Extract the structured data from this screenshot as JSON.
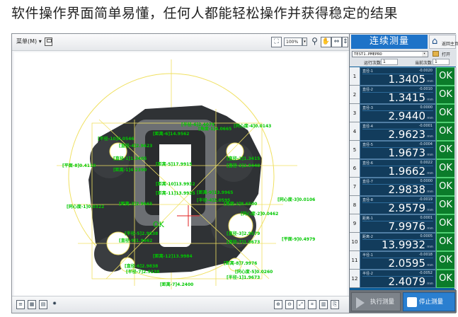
{
  "headline": "软件操作界面简单易懂，任何人都能轻松操作并获得稳定的结果",
  "toolbar": {
    "menu_label": "菜单(M)",
    "zoom_value": "100%"
  },
  "canvas": {
    "result": "OK",
    "labels": [
      "[同心度-4]0.0143",
      "[距离-6]14.9562",
      "[半径-10]0.0546",
      "[直径-4]2.9623",
      "[距离-5]17.9915",
      "[直径-1]1.3405",
      "[直径-2]1.3415",
      "[直径-3]2.9440",
      "[距离-1]4.2390",
      "[平面-8]0.4110",
      "[同心度-3]0.0106",
      "[距离-10]13.9932",
      "[距离-11]13.9935",
      "[半径-4]2.0595",
      "[距离-9]13.9965",
      "[同心度-1]0.0322",
      "[距离-3]2.9665",
      "[角度-2]8.6500",
      "[同心度-2]0.0462",
      "[半径-5]2.9838",
      "[直径-3]2.9579",
      "[直径-9]1.9662",
      "[直径-7]1.9673",
      "[距离-12]13.9984",
      "[直径-6]2.9838",
      "[平面-9]0.4979",
      "[半径-7]2.9238",
      "[距离-7]4.2400",
      "[距离-8]7.9976",
      "[同心度-5]0.0260",
      "[半径-6]2.4079",
      "[角度-1]4.0665",
      "[半径-1]1.9673"
    ]
  },
  "panel": {
    "title": "连续测量",
    "home_label": "返回主页",
    "program_name": "TEST1.PMEPRO",
    "open_label": "打开",
    "run_count_label": "运行次数",
    "run_count_value": "1",
    "current_count_label": "当前次数",
    "current_count_value": "1",
    "unit": "mm",
    "rows": [
      {
        "num": "1",
        "name": "直径-1",
        "dev": "-0.0020",
        "value": "1.3405",
        "status": "OK"
      },
      {
        "num": "2",
        "name": "直径-2",
        "dev": "-0.0010",
        "value": "1.3415",
        "status": "OK"
      },
      {
        "num": "3",
        "name": "直径-3",
        "dev": "0.0000",
        "value": "2.9440",
        "status": "OK"
      },
      {
        "num": "4",
        "name": "直径-4",
        "dev": "-0.0001",
        "value": "2.9623",
        "status": "OK"
      },
      {
        "num": "5",
        "name": "直径-5",
        "dev": "-0.0004",
        "value": "1.9673",
        "status": "OK"
      },
      {
        "num": "6",
        "name": "直径-6",
        "dev": "0.0022",
        "value": "1.9662",
        "status": "OK"
      },
      {
        "num": "7",
        "name": "直径-7",
        "dev": "0.0000",
        "value": "2.9838",
        "status": "OK"
      },
      {
        "num": "8",
        "name": "直径-8",
        "dev": "-0.0019",
        "value": "2.9579",
        "status": "OK"
      },
      {
        "num": "9",
        "name": "距离-1",
        "dev": "0.0001",
        "value": "7.9976",
        "status": "OK"
      },
      {
        "num": "10",
        "name": "距离-2",
        "dev": "0.0005",
        "value": "13.9932",
        "status": "OK"
      },
      {
        "num": "11",
        "name": "半径-1",
        "dev": "-0.0018",
        "value": "2.0595",
        "status": "OK"
      },
      {
        "num": "12",
        "name": "半径-2",
        "dev": "-0.0052",
        "value": "2.4079",
        "status": "OK"
      }
    ],
    "exec_label": "执行测量",
    "stop_label": "停止测量"
  },
  "colors": {
    "accent": "#1e73c8",
    "ok_green": "#0b7c2a",
    "annotation_green": "#00c800",
    "overlay_yellow": "#f0e060"
  },
  "icons": [
    "save-icon",
    "fit-icon",
    "zoom-icon",
    "pan-icon",
    "home-icon",
    "folder-icon",
    "play-icon",
    "stop-icon"
  ]
}
